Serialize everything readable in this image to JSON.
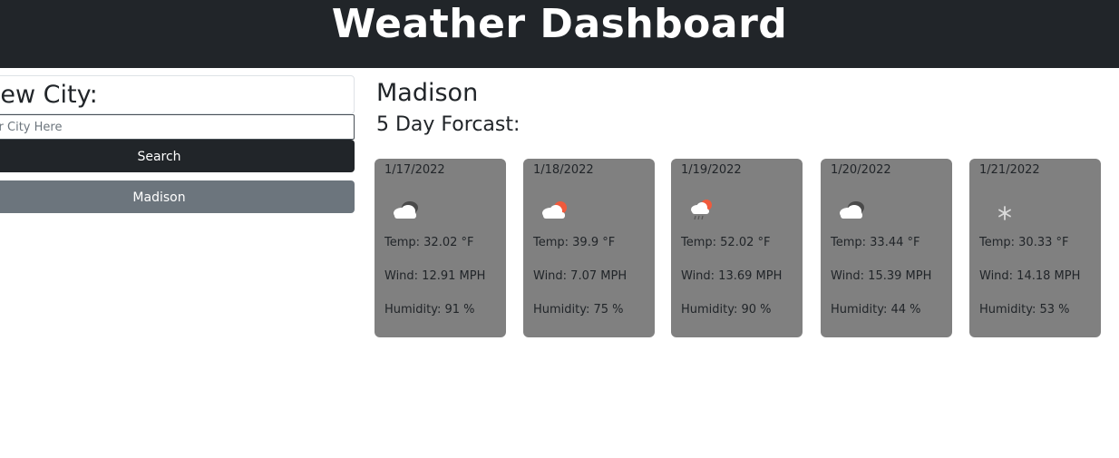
{
  "header": {
    "title": "Weather Dashboard"
  },
  "sidebar": {
    "heading": "View City:",
    "input_placeholder": "Enter City Here",
    "search_label": "Search",
    "history": [
      "Madison"
    ]
  },
  "main": {
    "city": "Madison",
    "forecast_title": "5 Day Forcast:",
    "forecast": [
      {
        "date": "1/17/2022",
        "icon": "cloud-dark-icon",
        "temp": "Temp: 32.02 °F",
        "wind": "Wind: 12.91 MPH",
        "humidity": "Humidity: 91 %"
      },
      {
        "date": "1/18/2022",
        "icon": "cloud-sun-icon",
        "temp": "Temp: 39.9 °F",
        "wind": "Wind: 7.07 MPH",
        "humidity": "Humidity: 75 %"
      },
      {
        "date": "1/19/2022",
        "icon": "rain-sun-icon",
        "temp": "Temp: 52.02 °F",
        "wind": "Wind: 13.69 MPH",
        "humidity": "Humidity: 90 %"
      },
      {
        "date": "1/20/2022",
        "icon": "cloud-dark-icon",
        "temp": "Temp: 33.44 °F",
        "wind": "Wind: 15.39 MPH",
        "humidity": "Humidity: 44 %"
      },
      {
        "date": "1/21/2022",
        "icon": "snowflake-icon",
        "temp": "Temp: 30.33 °F",
        "wind": "Wind: 14.18 MPH",
        "humidity": "Humidity: 53 %"
      }
    ]
  },
  "colors": {
    "header_bg": "#212529",
    "card_bg": "#808080",
    "history_button_bg": "#6c757d"
  }
}
